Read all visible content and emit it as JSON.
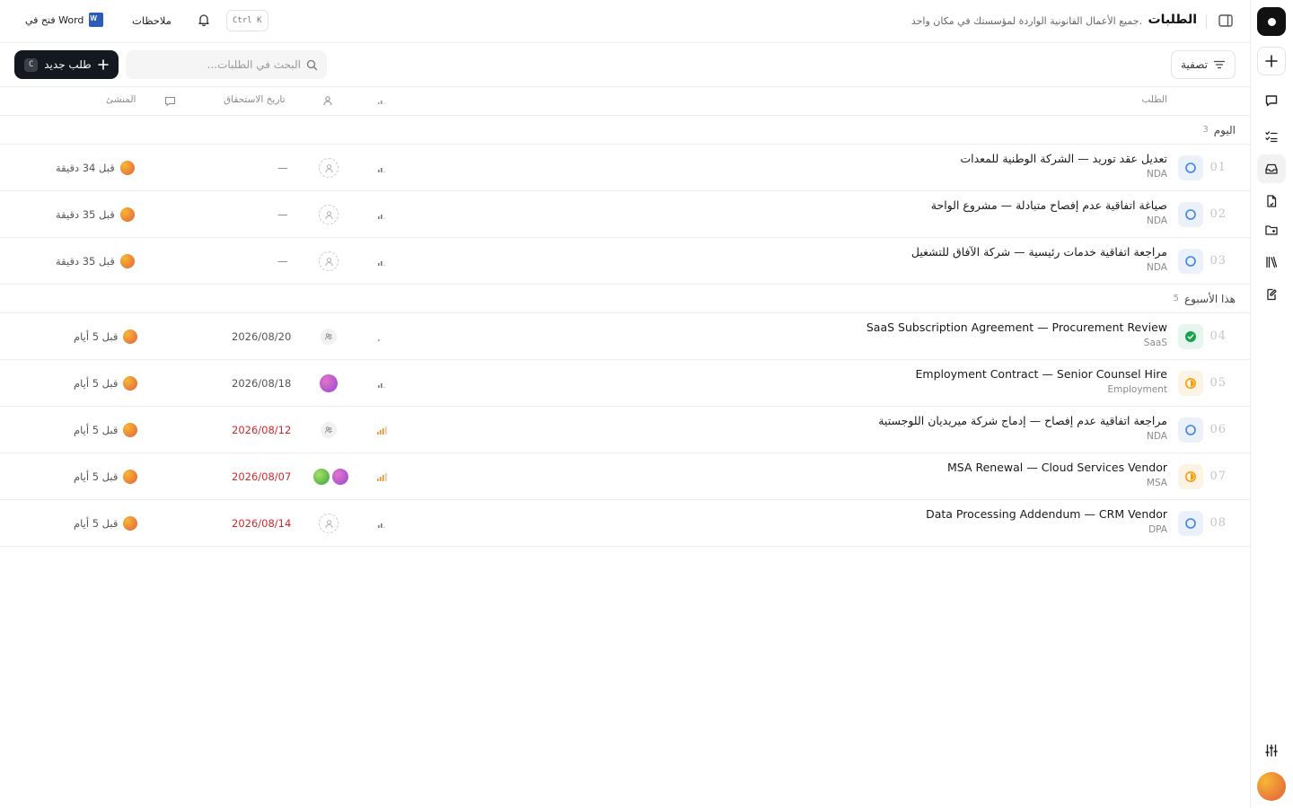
{
  "header": {
    "title": "الطلبات",
    "subtitle": "جميع الأعمال القانونية الواردة لمؤسستك في مكان واحد.",
    "kbd_hint": "Ctrl K",
    "notes_label": "ملاحظات",
    "word_label": "فتح في Word"
  },
  "toolbar": {
    "filter_label": "تصفية",
    "search_placeholder": "البحث في الطلبات...",
    "new_label": "طلب جديد",
    "new_shortcut": "C"
  },
  "columns": {
    "request": "الطلب",
    "due": "تاريخ الاستحقاق",
    "creator": "المنشئ"
  },
  "groups": [
    {
      "label": "اليوم",
      "count": "3"
    },
    {
      "label": "هذا الأسبوع",
      "count": "5"
    }
  ],
  "rows": [
    {
      "num": "01",
      "title": "تعديل عقد توريد — الشركة الوطنية للمعدات",
      "tag": "NDA",
      "status": "open",
      "priority": "low",
      "assignee": "none",
      "due": "—",
      "created": "قبل 34 دقيقة"
    },
    {
      "num": "02",
      "title": "صياغة اتفاقية عدم إفصاح متبادلة — مشروع الواحة",
      "tag": "NDA",
      "status": "open",
      "priority": "low",
      "assignee": "none",
      "due": "—",
      "created": "قبل 35 دقيقة"
    },
    {
      "num": "03",
      "title": "مراجعة اتفاقية خدمات رئيسية — شركة الآفاق للتشغيل",
      "tag": "NDA",
      "status": "open",
      "priority": "low",
      "assignee": "none",
      "due": "—",
      "created": "قبل 35 دقيقة"
    },
    {
      "num": "04",
      "title": "SaaS Subscription Agreement — Procurement Review",
      "tag": "SaaS",
      "status": "done",
      "priority": "none",
      "assignee": "team",
      "due": "2026/08/20",
      "created": "قبل 5 أيام"
    },
    {
      "num": "05",
      "title": "Employment Contract — Senior Counsel Hire",
      "tag": "Employment",
      "status": "progress",
      "priority": "low",
      "assignee": "person",
      "due": "2026/08/18",
      "created": "قبل 5 أيام"
    },
    {
      "num": "06",
      "title": "مراجعة اتفاقية عدم إفصاح — إدماج شركة ميريديان اللوجستية",
      "tag": "NDA",
      "status": "open",
      "priority": "high",
      "assignee": "team",
      "due": "2026/08/12",
      "due_overdue": true,
      "created": "قبل 5 أيام"
    },
    {
      "num": "07",
      "title": "MSA Renewal — Cloud Services Vendor",
      "tag": "MSA",
      "status": "progress",
      "priority": "high",
      "assignee": "pair",
      "due": "2026/08/07",
      "due_overdue": true,
      "created": "قبل 5 أيام"
    },
    {
      "num": "08",
      "title": "Data Processing Addendum — CRM Vendor",
      "tag": "DPA",
      "status": "open",
      "priority": "low",
      "assignee": "none",
      "due": "2026/08/14",
      "due_overdue": true,
      "created": "قبل 5 أيام"
    }
  ],
  "colors": {
    "accent_dark": "#141821",
    "status_open": "#3b82f6",
    "status_done": "#16a34a",
    "status_progress": "#f59e0b",
    "overdue": "#d0282d",
    "priority_high": "#f08a24"
  },
  "icons": {
    "sidebar": [
      "logo-icon",
      "plus-icon",
      "chat-icon",
      "checklist-icon",
      "inbox-icon",
      "document-icon",
      "folder-icon",
      "library-icon",
      "edit-icon",
      "sliders-icon"
    ],
    "topbar": [
      "panel-toggle-icon",
      "bell-icon",
      "word-icon"
    ],
    "toolbar": [
      "filter-icon",
      "search-icon",
      "plus-icon"
    ]
  }
}
